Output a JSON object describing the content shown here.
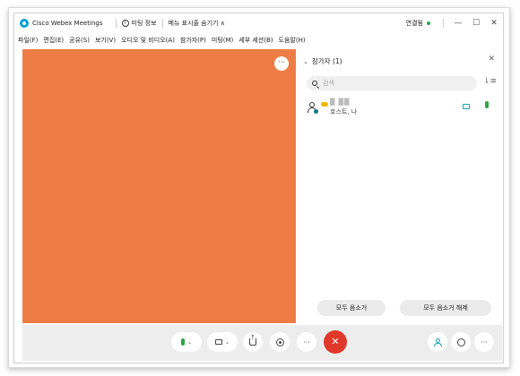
{
  "titlebar": {
    "app_title": "Cisco Webex Meetings",
    "meeting_info": "미팅 정보",
    "hide_menu": "메뉴 표시줄 숨기기 ∧",
    "connection_status": "연결됨",
    "minimize": "—",
    "maximize": "☐",
    "close": "✕"
  },
  "menubar": {
    "items": [
      {
        "label": "파일(F)"
      },
      {
        "label": "편집(E)"
      },
      {
        "label": "공유(S)"
      },
      {
        "label": "보기(V)"
      },
      {
        "label": "오디오 및 비디오(A)"
      },
      {
        "label": "참가자(P)"
      },
      {
        "label": "미팅(M)"
      },
      {
        "label": "세부 세션(B)"
      },
      {
        "label": "도움말(H)"
      }
    ]
  },
  "video": {
    "more_label": "···",
    "background_color": "#ed7d45"
  },
  "participants_panel": {
    "title": "참가자 (1)",
    "close_label": "✕",
    "search_placeholder": "검색",
    "sort_label": "⇂≡",
    "participants": [
      {
        "name": "█ ██",
        "role": "호스트, 나"
      }
    ],
    "mute_all": "모두 음소거",
    "unmute_all": "모두 음소거 해제"
  },
  "controls": {
    "more_label": "···",
    "end_label": "✕",
    "right_more_label": "···",
    "caret": "⌄"
  },
  "colors": {
    "accent": "#1aa3b5",
    "end_call": "#e0392b",
    "connected": "#27a745",
    "mic": "#2aa845"
  }
}
